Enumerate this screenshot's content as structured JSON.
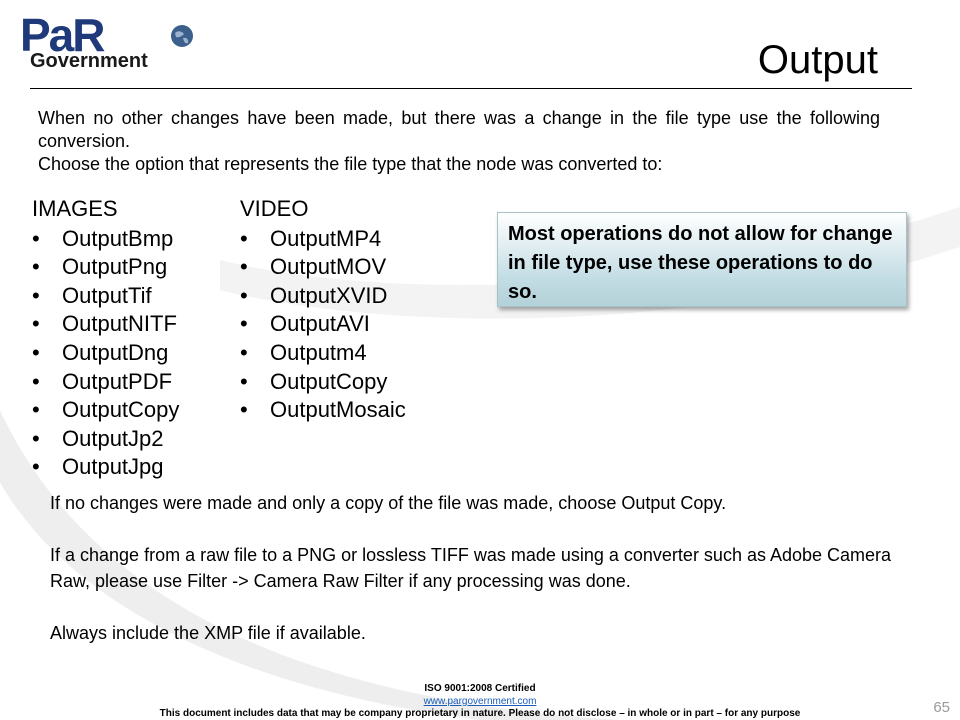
{
  "logo": {
    "top": "PaR",
    "bottom": "Government"
  },
  "title": "Output",
  "intro": [
    "When no other changes have been made, but there was a change in the file type use the following conversion.",
    "Choose the option that represents the file type that the node was converted to:"
  ],
  "images": {
    "heading": "IMAGES",
    "items": [
      "OutputBmp",
      "OutputPng",
      "OutputTif",
      "OutputNITF",
      "OutputDng",
      "OutputPDF",
      "OutputCopy",
      "OutputJp2",
      "OutputJpg"
    ]
  },
  "video": {
    "heading": "VIDEO",
    "items": [
      "OutputMP4",
      "OutputMOV",
      "OutputXVID",
      "OutputAVI",
      "Outputm4",
      "OutputCopy",
      "OutputMosaic"
    ]
  },
  "bullet": "•",
  "callout": "Most operations do not allow for change in file type, use these operations to do so.",
  "notes": [
    "If no changes were made and only a copy of the file was made, choose Output Copy.",
    "If a change from a raw file to a PNG or lossless TIFF was made using a converter such as Adobe Camera Raw, please use Filter -> Camera Raw Filter if any processing was done.",
    "Always include the XMP file if available."
  ],
  "footer": {
    "certified": "ISO 9001:2008 Certified",
    "link": "www.pargovernment.com",
    "disclaimer": "This document includes data that may be company proprietary in nature. Please do not disclose – in whole or in part – for any purpose"
  },
  "page_number": "65",
  "colors": {
    "logo_blue": "#1f3a7a",
    "callout_fill": "#c3dde4",
    "link": "#1a5cb8"
  }
}
